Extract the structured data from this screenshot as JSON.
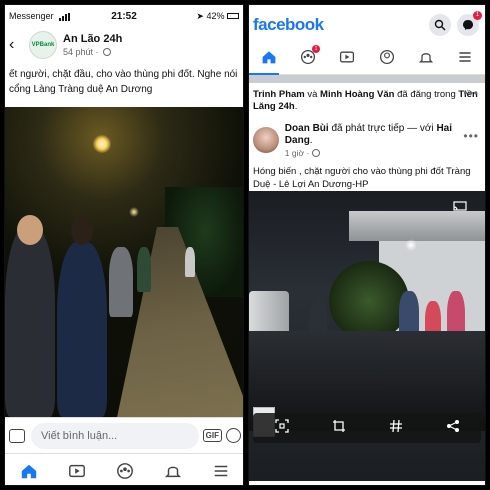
{
  "left": {
    "status": {
      "carrier": "Messenger",
      "time": "21:52",
      "battery": "42%"
    },
    "page": {
      "name": "An Lão 24h",
      "time": "54 phút",
      "avatar_text": "VPBank"
    },
    "post_text_lines": [
      "ết người, chặt đầu, cho vào thùng phi đốt. Nghe nói",
      "cổng Làng Tràng duệ  An Dương"
    ],
    "comment_placeholder": "Viết bình luận...",
    "gif_label": "GIF",
    "tabs": [
      "home-icon",
      "video-icon",
      "groups-icon",
      "bell-icon",
      "menu-icon"
    ],
    "accent": "#1877f2"
  },
  "right": {
    "logo": "facebook",
    "notif_count": "1",
    "nav_badge": "1",
    "shared_by": {
      "part1": "Trinh Pham",
      "connector": " và ",
      "part2": "Minh Hoàng Văn",
      "suffix": " đã đăng trong ",
      "group": "Tiền Lăng 24h",
      "end": "."
    },
    "post": {
      "user": "Doan Bùi",
      "action": " đã phát trực tiếp — với ",
      "with": "Hai Dang",
      "end": ".",
      "time": "1 giờ",
      "text": "Hóng biến , chặt người cho vào thùng phi đốt Tràng Duệ - Lê Lợi An Dương-HP"
    },
    "video_controls": [
      "scan-icon",
      "crop-rotate-icon",
      "hashtag-icon",
      "share-icon"
    ]
  }
}
